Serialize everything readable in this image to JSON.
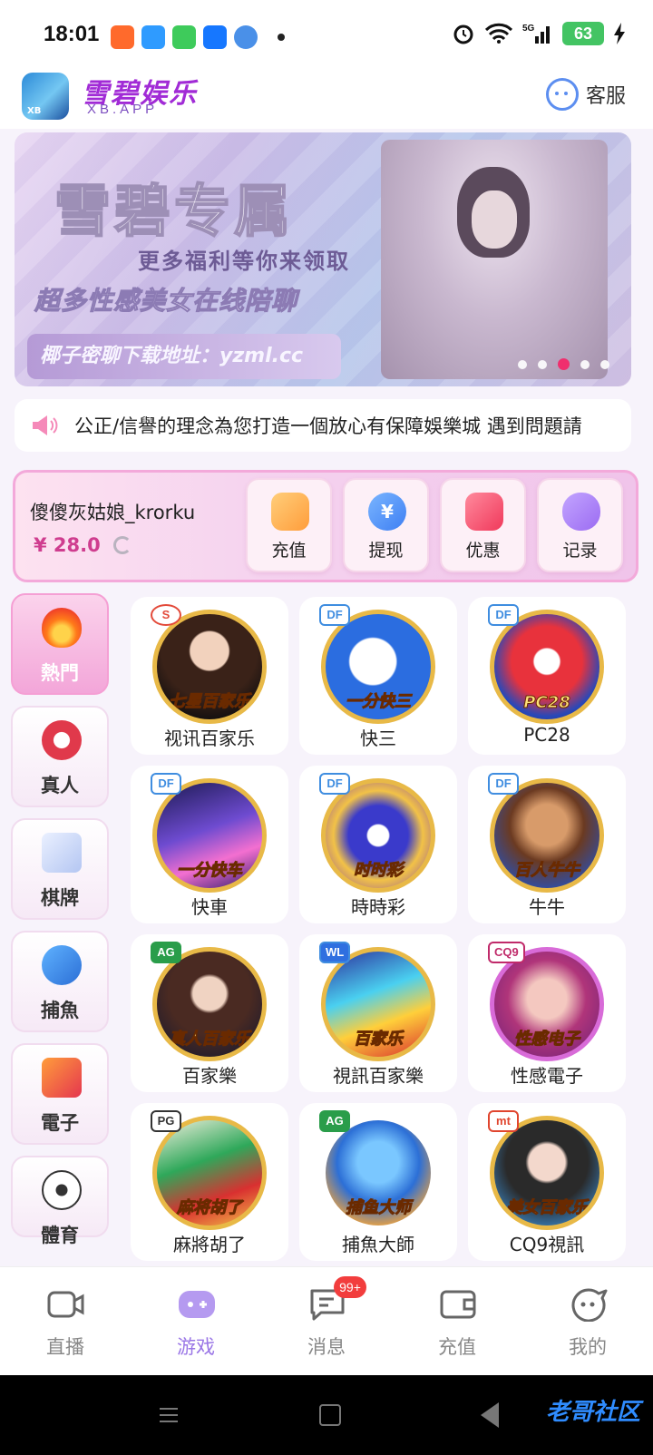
{
  "status_bar": {
    "time": "18:01",
    "battery": "63",
    "network": "5G"
  },
  "header": {
    "brand_name": "雪碧娱乐",
    "brand_sub": "XB.APP",
    "customer_service": "客服"
  },
  "banner": {
    "title": "雪碧专属",
    "line1": "更多福利等你来领取",
    "line2": "超多性感美女在线陪聊",
    "url_text": "椰子密聊下载地址：yzml.cc",
    "active_slide": 3,
    "slide_count": 5
  },
  "notice": {
    "text": "公正/信譽的理念為您打造一個放心有保障娛樂城  遇到問題請"
  },
  "wallet": {
    "username": "傻傻灰姑娘_krorku",
    "balance": "¥ 28.0",
    "actions": [
      {
        "label": "充值",
        "icon": "wallet-icon"
      },
      {
        "label": "提现",
        "icon": "yen-coin-icon"
      },
      {
        "label": "优惠",
        "icon": "ticket-icon"
      },
      {
        "label": "记录",
        "icon": "gamepad-icon"
      }
    ]
  },
  "categories": [
    {
      "label": "熱門",
      "icon": "flame-icon",
      "active": true
    },
    {
      "label": "真人",
      "icon": "poker-chip-icon",
      "active": false
    },
    {
      "label": "棋牌",
      "icon": "playing-cards-icon",
      "active": false
    },
    {
      "label": "捕魚",
      "icon": "shark-icon",
      "active": false
    },
    {
      "label": "電子",
      "icon": "slot-777-icon",
      "active": false
    },
    {
      "label": "體育",
      "icon": "soccer-ball-icon",
      "active": false
    }
  ],
  "games": [
    {
      "name": "视讯百家乐",
      "thumb_text": "七星百家乐",
      "provider": "S"
    },
    {
      "name": "快三",
      "thumb_text": "一分快三",
      "provider": "DF"
    },
    {
      "name": "PC28",
      "thumb_text": "PC28",
      "provider": "DF"
    },
    {
      "name": "快車",
      "thumb_text": "一分快车",
      "provider": "DF"
    },
    {
      "name": "時時彩",
      "thumb_text": "时时彩",
      "provider": "DF"
    },
    {
      "name": "牛牛",
      "thumb_text": "百人牛牛",
      "provider": "DF"
    },
    {
      "name": "百家樂",
      "thumb_text": "真人百家乐",
      "provider": "AG"
    },
    {
      "name": "視訊百家樂",
      "thumb_text": "百家乐",
      "provider": "WL"
    },
    {
      "name": "性感電子",
      "thumb_text": "性感电子",
      "provider": "CQ9"
    },
    {
      "name": "麻將胡了",
      "thumb_text": "麻将胡了",
      "provider": "PG"
    },
    {
      "name": "捕魚大師",
      "thumb_text": "捕鱼大师",
      "provider": "AG"
    },
    {
      "name": "CQ9視訊",
      "thumb_text": "美女百家乐",
      "provider": "mt"
    }
  ],
  "bottom_nav": [
    {
      "label": "直播",
      "icon": "video-camera-icon",
      "active": false
    },
    {
      "label": "游戏",
      "icon": "gamepad-icon",
      "active": true
    },
    {
      "label": "消息",
      "icon": "message-icon",
      "active": false,
      "badge": "99+"
    },
    {
      "label": "充值",
      "icon": "wallet-icon",
      "active": false
    },
    {
      "label": "我的",
      "icon": "smiley-icon",
      "active": false
    }
  ],
  "watermark": "老哥社区",
  "colors": {
    "accent": "#a12bd6",
    "pink": "#f3a6d9",
    "badge_red": "#f23d3d",
    "active_nav": "#9a76e6"
  }
}
